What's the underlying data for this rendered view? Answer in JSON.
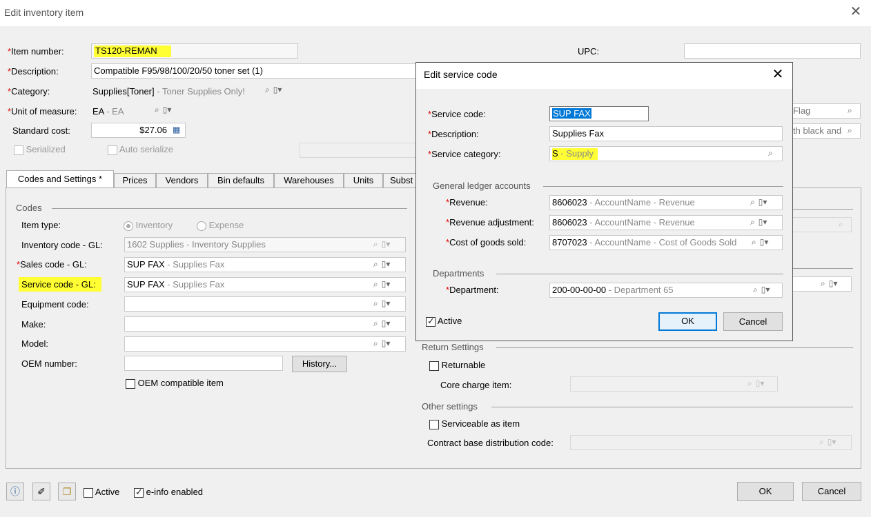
{
  "window": {
    "title": "Edit inventory item",
    "close_label": "✕"
  },
  "form": {
    "item_number": {
      "label": "Item number:",
      "value": "TS120-REMAN"
    },
    "description": {
      "label": "Description:",
      "value": "Compatible F95/98/100/20/50 toner set (1)"
    },
    "category": {
      "label": "Category:",
      "code": "Supplies[Toner]",
      "desc": " - Toner Supplies Only!"
    },
    "uom": {
      "label": "Unit of measure:",
      "code": "EA",
      "desc": " - EA"
    },
    "standard_cost": {
      "label": "Standard cost:",
      "value": "$27.06"
    },
    "serialized": {
      "label": "Serialized"
    },
    "auto_serialize": {
      "label": "Auto serialize"
    },
    "upc": {
      "label": "UPC:",
      "value": ""
    },
    "right_field1_value": "Flag",
    "right_field2_value": "th black and"
  },
  "tabs": [
    "Codes and Settings *",
    "Prices",
    "Vendors",
    "Bin defaults",
    "Warehouses",
    "Units",
    "Subst"
  ],
  "codes": {
    "group_title": "Codes",
    "item_type": {
      "label": "Item type:",
      "options": [
        "Inventory",
        "Expense"
      ],
      "selected": "Inventory"
    },
    "inventory_code": {
      "label": "Inventory code - GL:",
      "code": "1602 Supplies",
      "desc": " - Inventory Supplies"
    },
    "sales_code": {
      "label": "Sales code - GL:",
      "code": "SUP FAX",
      "desc": " - Supplies Fax"
    },
    "service_code": {
      "label": "Service code - GL:",
      "code": "SUP FAX",
      "desc": " - Supplies Fax"
    },
    "equipment_code": {
      "label": "Equipment code:",
      "value": ""
    },
    "make": {
      "label": "Make:",
      "value": ""
    },
    "model": {
      "label": "Model:",
      "value": ""
    },
    "oem_number": {
      "label": "OEM number:",
      "value": ""
    },
    "history_button": "History...",
    "oem_compatible": {
      "label": "OEM compatible item",
      "checked": false
    }
  },
  "return_settings": {
    "group_title": "Return Settings",
    "returnable": {
      "label": "Returnable",
      "checked": false
    },
    "core_charge": {
      "label": "Core charge item:",
      "value": ""
    }
  },
  "other_settings": {
    "group_title": "Other settings",
    "serviceable": {
      "label": "Serviceable as item",
      "checked": false
    },
    "contract_base": {
      "label": "Contract base distribution code:",
      "value": ""
    }
  },
  "footer": {
    "active": {
      "label": "Active",
      "checked": false
    },
    "einfo": {
      "label": "e-info enabled",
      "checked": true
    },
    "ok": "OK",
    "cancel": "Cancel"
  },
  "dialog": {
    "title": "Edit service code",
    "close_label": "✕",
    "service_code": {
      "label": "Service code:",
      "value": "SUP FAX"
    },
    "description": {
      "label": "Description:",
      "value": "Supplies Fax"
    },
    "service_category": {
      "label": "Service category:",
      "code": "S",
      "desc": " - Supply"
    },
    "gl_group": "General ledger accounts",
    "revenue": {
      "label": "Revenue:",
      "code": "8606023",
      "desc": " - AccountName - Revenue"
    },
    "revenue_adj": {
      "label": "Revenue adjustment:",
      "code": "8606023",
      "desc": " - AccountName - Revenue"
    },
    "cogs": {
      "label": "Cost of goods sold:",
      "code": "8707023",
      "desc": " - AccountName - Cost of Goods Sold"
    },
    "dept_group": "Departments",
    "department": {
      "label": "Department:",
      "code": "200-00-00-00",
      "desc": " - Department 65"
    },
    "active": {
      "label": "Active",
      "checked": true
    },
    "ok": "OK",
    "cancel": "Cancel"
  },
  "colors": {
    "highlight": "#ffff33",
    "required": "#e00000",
    "selection": "#0078d7"
  }
}
